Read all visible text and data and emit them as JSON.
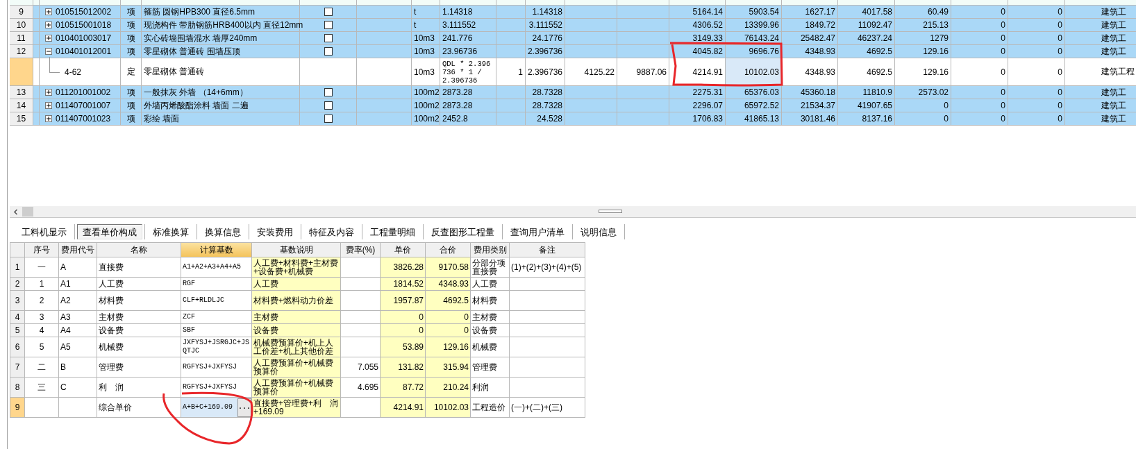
{
  "main_grid": {
    "rows": [
      {
        "kind": "item",
        "number": "9",
        "expanded": false,
        "selected": false,
        "code": "010515012002",
        "type": "项",
        "name": "箍筋 圆钢HPB300 直径6.5mm",
        "checked": false,
        "cells": {
          "unit": "t",
          "expression": "1.14318",
          "quantity": "1.14318",
          "unit_price": "5164.14",
          "total": "5903.54",
          "col_15": "1627.17",
          "col_16": "4017.58",
          "col_17": "60.49",
          "col_18": "0",
          "col_19": "0",
          "col_20": "建筑工"
        }
      },
      {
        "kind": "item",
        "number": "10",
        "expanded": false,
        "selected": false,
        "code": "010515001018",
        "type": "项",
        "name": "现浇构件 带肋钢筋HRB400以内 直径12mm",
        "checked": false,
        "cells": {
          "unit": "t",
          "expression": "3.111552",
          "quantity": "3.111552",
          "unit_price": "4306.52",
          "total": "13399.96",
          "col_15": "1849.72",
          "col_16": "11092.47",
          "col_17": "215.13",
          "col_18": "0",
          "col_19": "0",
          "col_20": "建筑工"
        }
      },
      {
        "kind": "item",
        "number": "11",
        "expanded": false,
        "selected": false,
        "code": "010401003017",
        "type": "项",
        "name": "实心砖墙围墙混水 墙厚240mm",
        "checked": false,
        "cells": {
          "unit": "10m3",
          "expression": "241.776",
          "quantity": "24.1776",
          "unit_price": "3149.33",
          "total": "76143.24",
          "col_15": "25482.47",
          "col_16": "46237.24",
          "col_17": "1279",
          "col_18": "0",
          "col_19": "0",
          "col_20": "建筑工"
        }
      },
      {
        "kind": "item",
        "number": "12",
        "expanded": true,
        "selected": false,
        "code": "010401012001",
        "type": "项",
        "name": "零星砌体 普通砖 围墙压顶",
        "checked": false,
        "cells": {
          "unit": "10m3",
          "expression": "23.96736",
          "quantity": "2.396736",
          "unit_price": "4045.82",
          "total": "9696.76",
          "col_15": "4348.93",
          "col_16": "4692.5",
          "col_17": "129.16",
          "col_18": "0",
          "col_19": "0",
          "col_20": "建筑工"
        }
      },
      {
        "kind": "quota",
        "selected": true,
        "code": "4-62",
        "type": "定",
        "name": "零星砌体 普通砖",
        "cells": {
          "unit": "10m3",
          "expression": "QDL * 2.396736 * 1 / 2.396736",
          "col_9": "1",
          "quantity": "2.396736",
          "col_11": "4125.22",
          "col_12": "9887.06",
          "unit_price": "4214.91",
          "total": "10102.03",
          "col_15": "4348.93",
          "col_16": "4692.5",
          "col_17": "129.16",
          "col_18": "0",
          "col_19": "0",
          "col_20": "建筑工程"
        }
      },
      {
        "kind": "item",
        "number": "13",
        "expanded": false,
        "selected": false,
        "code": "011201001002",
        "type": "项",
        "name": "一般抹灰 外墙 （14+6mm）",
        "checked": false,
        "cells": {
          "unit": "100m2",
          "expression": "2873.28",
          "quantity": "28.7328",
          "unit_price": "2275.31",
          "total": "65376.03",
          "col_15": "45360.18",
          "col_16": "11810.9",
          "col_17": "2573.02",
          "col_18": "0",
          "col_19": "0",
          "col_20": "建筑工"
        }
      },
      {
        "kind": "item",
        "number": "14",
        "expanded": false,
        "selected": false,
        "code": "011407001007",
        "type": "项",
        "name": "外墙丙烯酸酯涂料 墙面 二遍",
        "checked": false,
        "cells": {
          "unit": "100m2",
          "expression": "2873.28",
          "quantity": "28.7328",
          "unit_price": "2296.07",
          "total": "65972.52",
          "col_15": "21534.37",
          "col_16": "41907.65",
          "col_17": "0",
          "col_18": "0",
          "col_19": "0",
          "col_20": "建筑工"
        }
      },
      {
        "kind": "item",
        "number": "15",
        "expanded": false,
        "selected": false,
        "code": "011407001023",
        "type": "项",
        "name": "彩绘 墙面",
        "checked": false,
        "cells": {
          "unit": "100m2",
          "expression": "2452.8",
          "quantity": "24.528",
          "unit_price": "1706.83",
          "total": "41865.13",
          "col_15": "30181.46",
          "col_16": "8137.16",
          "col_17": "0",
          "col_18": "0",
          "col_19": "0",
          "col_20": "建筑工"
        }
      }
    ]
  },
  "detail_tabs": [
    {
      "label": "工料机显示",
      "selected": false
    },
    {
      "label": "查看单价构成",
      "selected": true
    },
    {
      "label": "标准换算",
      "selected": false
    },
    {
      "label": "换算信息",
      "selected": false
    },
    {
      "label": "安装费用",
      "selected": false
    },
    {
      "label": "特征及内容",
      "selected": false
    },
    {
      "label": "工程量明细",
      "selected": false
    },
    {
      "label": "反查图形工程量",
      "selected": false
    },
    {
      "label": "查询用户清单",
      "selected": false
    },
    {
      "label": "说明信息",
      "selected": false
    }
  ],
  "cost_table": {
    "columns": [
      {
        "label": "序号",
        "selected": false
      },
      {
        "label": "费用代号",
        "selected": false
      },
      {
        "label": "名称",
        "selected": false
      },
      {
        "label": "计算基数",
        "selected": true
      },
      {
        "label": "基数说明",
        "selected": false
      },
      {
        "label": "费率(%)",
        "selected": false
      },
      {
        "label": "单价",
        "selected": false
      },
      {
        "label": "合价",
        "selected": false
      },
      {
        "label": "费用类别",
        "selected": false
      },
      {
        "label": "备注",
        "selected": false
      }
    ],
    "rows": [
      {
        "number": "1",
        "selected": false,
        "seq": "一",
        "code": "A",
        "name": "直接费",
        "base": "A1+A2+A3+A4+A5",
        "base_desc": "人工费+材料费+主材费+设备费+机械费",
        "unit_price": "3826.28",
        "total": "9170.58",
        "category": "分部分项直接费",
        "remark": "(1)+(2)+(3)+(4)+(5)"
      },
      {
        "number": "2",
        "selected": false,
        "seq": "1",
        "code": "A1",
        "name": "人工费",
        "base": "RGF",
        "base_desc": "人工费",
        "unit_price": "1814.52",
        "total": "4348.93",
        "category": "人工费"
      },
      {
        "number": "3",
        "selected": false,
        "seq": "2",
        "code": "A2",
        "name": "材料费",
        "base": "CLF+RLDLJC",
        "base_desc": "材料费+燃料动力价差",
        "unit_price": "1957.87",
        "total": "4692.5",
        "category": "材料费"
      },
      {
        "number": "4",
        "selected": false,
        "seq": "3",
        "code": "A3",
        "name": "主材费",
        "base": "ZCF",
        "base_desc": "主材费",
        "unit_price": "0",
        "total": "0",
        "category": "主材费"
      },
      {
        "number": "5",
        "selected": false,
        "seq": "4",
        "code": "A4",
        "name": "设备费",
        "base": "SBF",
        "base_desc": "设备费",
        "unit_price": "0",
        "total": "0",
        "category": "设备费"
      },
      {
        "number": "6",
        "selected": false,
        "seq": "5",
        "code": "A5",
        "name": "机械费",
        "base": "JXFYSJ+JSRGJC+JSQTJC",
        "base_desc": "机械费预算价+机上人工价差+机上其他价差",
        "unit_price": "53.89",
        "total": "129.16",
        "category": "机械费"
      },
      {
        "number": "7",
        "selected": false,
        "seq": "二",
        "code": "B",
        "name": "管理费",
        "base": "RGFYSJ+JXFYSJ",
        "base_desc": "人工费预算价+机械费预算价",
        "rate": "7.055",
        "unit_price": "131.82",
        "total": "315.94",
        "category": "管理费"
      },
      {
        "number": "8",
        "selected": false,
        "seq": "三",
        "code": "C",
        "name": "利　润",
        "base": "RGFYSJ+JXFYSJ",
        "base_desc": "人工费预算价+机械费预算价",
        "rate": "4.695",
        "unit_price": "87.72",
        "total": "210.24",
        "category": "利润"
      },
      {
        "number": "9",
        "selected": true,
        "name": "综合单价",
        "base": "A+B+C+169.09",
        "edit_button": "...",
        "base_desc": "直接费+管理费+利　润+169.09",
        "unit_price": "4214.91",
        "total": "10102.03",
        "category": "工程造价",
        "remark": "(一)+(二)+(三)"
      }
    ]
  }
}
